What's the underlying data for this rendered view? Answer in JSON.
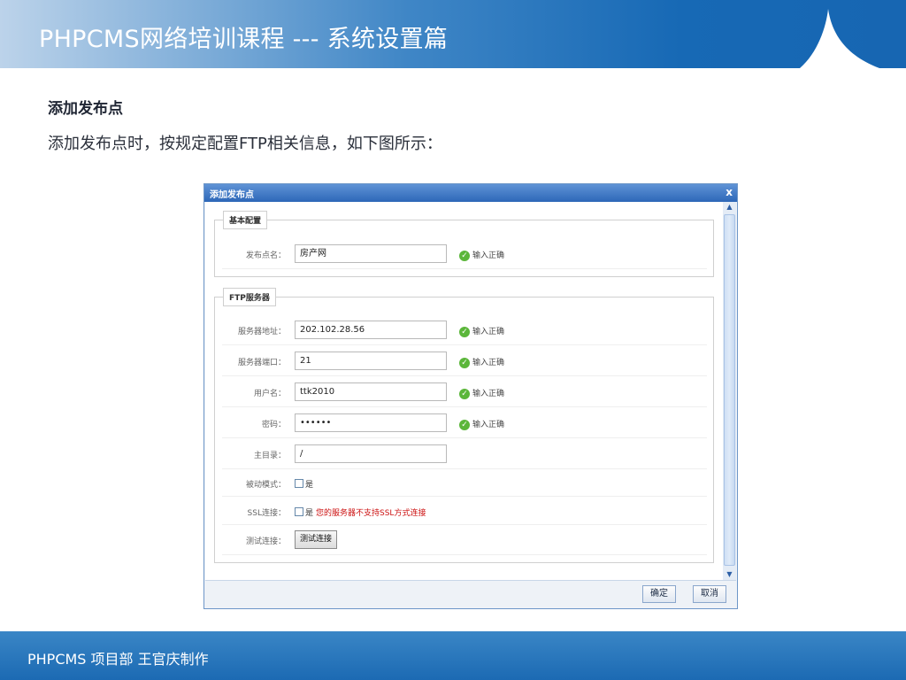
{
  "header": {
    "title": "PHPCMS网络培训课程 ---  系统设置篇"
  },
  "section": {
    "heading": "添加发布点",
    "description": "添加发布点时，按规定配置FTP相关信息，如下图所示："
  },
  "dialog": {
    "title": "添加发布点",
    "close_glyph": "x",
    "basic_legend": "基本配置",
    "ftp_legend": "FTP服务器",
    "ok_label": "确定",
    "cancel_label": "取消",
    "fields": {
      "publish_name": {
        "label": "发布点名：",
        "value": "房产网",
        "status": "输入正确"
      },
      "server_address": {
        "label": "服务器地址：",
        "value": "202.102.28.56",
        "status": "输入正确"
      },
      "server_port": {
        "label": "服务器端口：",
        "value": "21",
        "status": "输入正确"
      },
      "username": {
        "label": "用户名：",
        "value": "ttk2010",
        "status": "输入正确"
      },
      "password": {
        "label": "密码：",
        "value": "••••••",
        "status": "输入正确"
      },
      "home_dir": {
        "label": "主目录：",
        "value": "/"
      },
      "passive_mode": {
        "label": "被动模式：",
        "option": "是"
      },
      "ssl": {
        "label": "SSL连接：",
        "option": "是",
        "warning": "您的服务器不支持SSL方式连接"
      },
      "test_connection": {
        "label": "测试连接：",
        "button": "测试连接"
      }
    }
  },
  "footer": {
    "text": "PHPCMS 项目部 王官庆制作"
  },
  "colors": {
    "header_blue": "#1769b5",
    "ok_green": "#5bb63a",
    "warning_red": "#cc1111"
  },
  "icons": {
    "status_ok": "check-circle-icon",
    "close": "close-icon",
    "scroll_up": "chevron-up-icon",
    "scroll_down": "chevron-down-icon"
  }
}
